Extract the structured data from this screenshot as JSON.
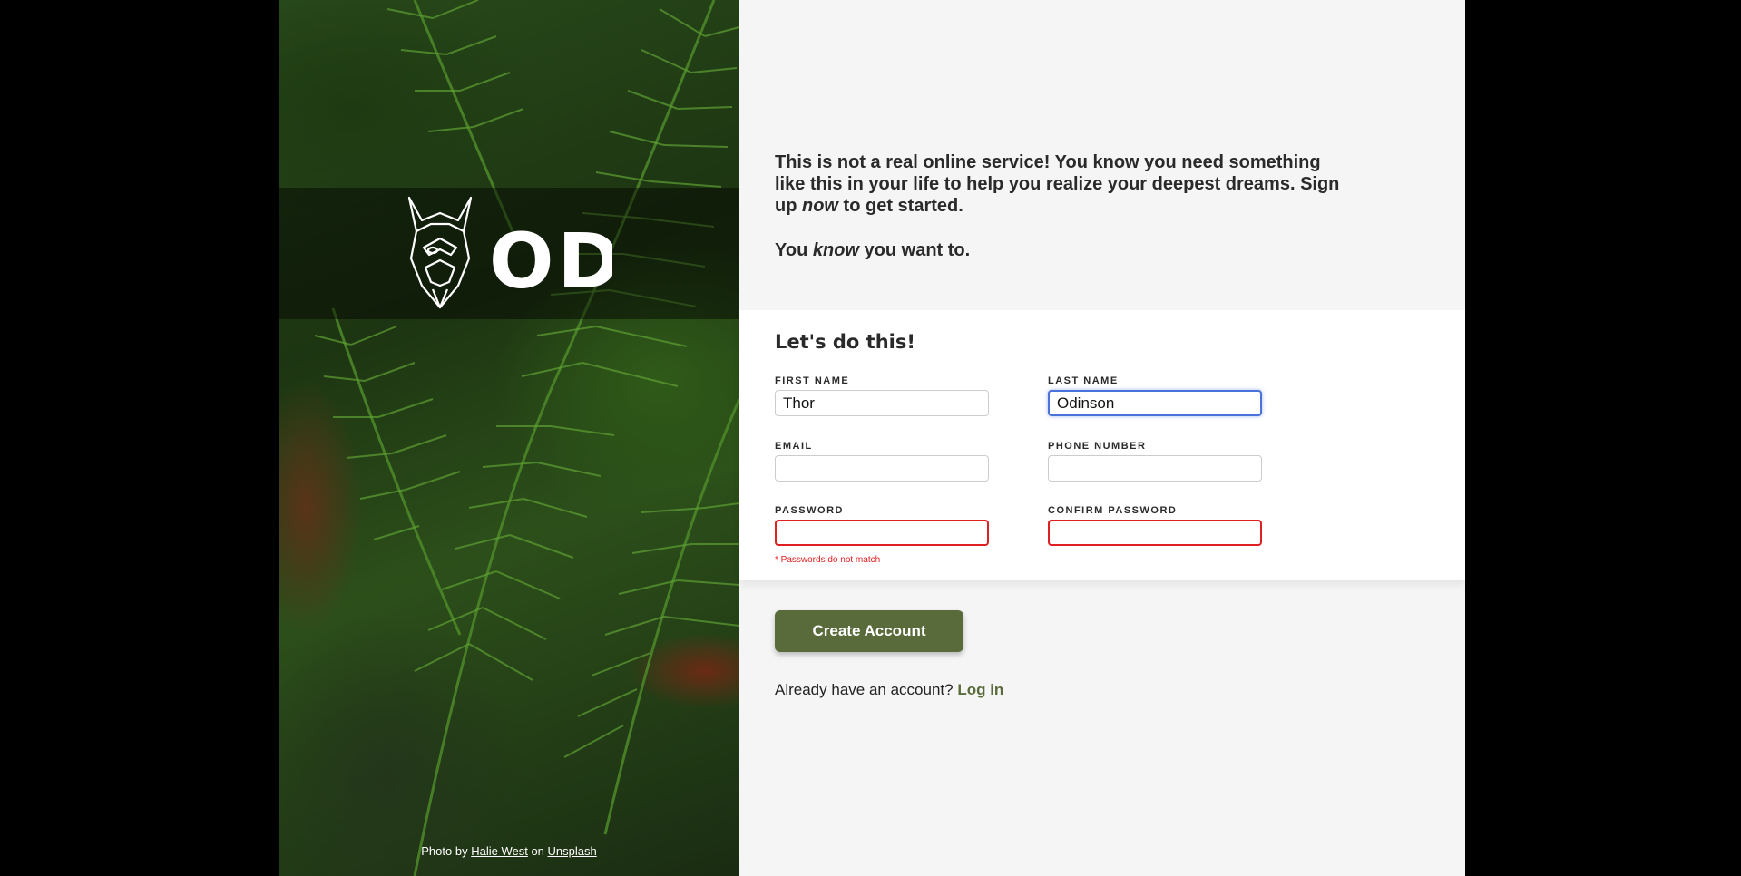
{
  "intro": {
    "line1": "This is not a real online service! You know you need something like this in your life to help you realize your deepest dreams.",
    "signup_pre": "Sign up ",
    "signup_em": "now",
    "signup_post": " to get started.",
    "know_pre": "You ",
    "know_em": "know",
    "know_post": " you want to."
  },
  "logo": {
    "text": "ODIN",
    "icon": "viking-helmet-icon"
  },
  "credit": {
    "prefix": "Photo by ",
    "author": "Halie West",
    "mid": " on ",
    "site": "Unsplash"
  },
  "form": {
    "title": "Let's do this!",
    "fields": {
      "first_name": {
        "label": "FIRST NAME",
        "value": "Thor"
      },
      "last_name": {
        "label": "LAST NAME",
        "value": "Odinson"
      },
      "email": {
        "label": "EMAIL",
        "value": ""
      },
      "phone": {
        "label": "PHONE NUMBER",
        "value": ""
      },
      "password": {
        "label": "PASSWORD",
        "value": ""
      },
      "confirm_password": {
        "label": "CONFIRM PASSWORD",
        "value": ""
      }
    },
    "error": "* Passwords do not match"
  },
  "submit_label": "Create Account",
  "login": {
    "prompt": "Already have an account? ",
    "link": "Log in"
  },
  "colors": {
    "accent": "#5a6b3b",
    "error": "#e02020",
    "focus": "#4a72d8"
  }
}
